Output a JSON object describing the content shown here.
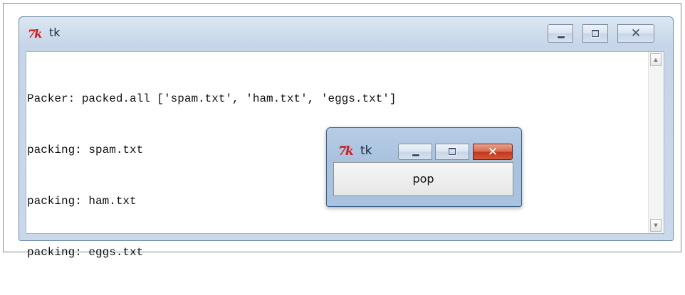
{
  "main_window": {
    "title": "tk",
    "logo_text": "7k",
    "text_lines": [
      "Packer: packed.all ['spam.txt', 'ham.txt', 'eggs.txt']",
      "packing: spam.txt",
      "packing: ham.txt",
      "packing: eggs.txt"
    ],
    "close_glyph": "✕"
  },
  "popup_window": {
    "title": "tk",
    "logo_text": "7k",
    "button_label": "pop",
    "close_glyph": "✕"
  },
  "icons": {
    "scroll_up": "▲",
    "scroll_down": "▼"
  },
  "colors": {
    "tk_logo": "#cc1a1a",
    "close_button_active": "#c2361c"
  }
}
